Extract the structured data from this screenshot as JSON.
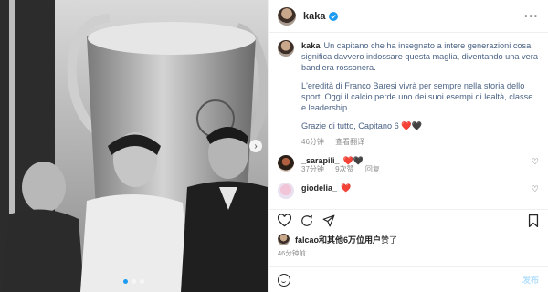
{
  "post": {
    "username": "kaka",
    "verified": true,
    "photo_alt": "",
    "carousel": {
      "count": 3,
      "active_index": 0
    }
  },
  "caption": {
    "username": "kaka",
    "paragraphs": [
      "Un capitano che ha insegnato a intere generazioni cosa significa davvero indossare questa maglia, diventando una vera bandiera rossonera.",
      "L'eredità di Franco Baresi vivrà per sempre nella storia dello sport. Oggi il calcio perde uno dei suoi esempi di lealtà, classe e leadership.",
      "Grazie di tutto, Capitano 6 ❤️🖤"
    ],
    "time": "46分钟",
    "translate": "查看翻译"
  },
  "comments": [
    {
      "username": "_sarapili_",
      "text": "❤️🖤",
      "time": "37分钟",
      "likes": "9次赞",
      "reply": "回复"
    },
    {
      "username": "giodelia_",
      "text": "❤️",
      "time": "",
      "likes": "",
      "reply": ""
    }
  ],
  "likes": {
    "text_bold": "falcao和其他6万位用户",
    "text_rest": "赞了"
  },
  "post_time": "46分钟前",
  "composer": {
    "placeholder": "",
    "post_label": "发布"
  },
  "colors": {
    "accent": "#0095f6",
    "verified": "#1d9bf0",
    "heart": "#ed4956"
  }
}
